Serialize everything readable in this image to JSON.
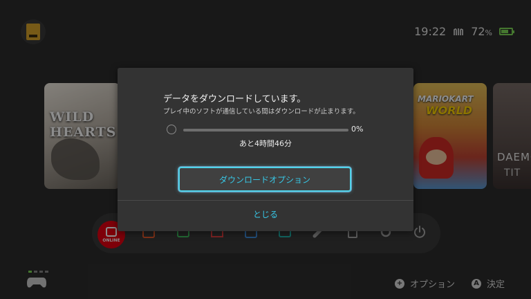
{
  "status": {
    "time": "19:22",
    "battery_percent": "72",
    "battery_unit": "%",
    "battery_level": 0.72
  },
  "games": [
    "WILD HEARTS",
    "MARIO KART WORLD",
    "DAEMON X MACHINA TITANIC SCION"
  ],
  "game_tile_text": {
    "wild_hearts": "WILD HEARTS",
    "mario_kart_1": "MARIOKART",
    "mario_kart_2": "WORLD",
    "daemon": "DAEMO",
    "daemon_sub": "TIT"
  },
  "dock": {
    "online_label": "ONLINE"
  },
  "dialog": {
    "title": "データをダウンロードしています。",
    "subtitle": "プレイ中のソフトが通信している間はダウンロードが止まります。",
    "progress_label": "0%",
    "progress_value": 0.0,
    "time_remaining": "あと4時間46分",
    "options_button": "ダウンロードオプション",
    "close_button": "とじる"
  },
  "bottom_hints": {
    "plus_symbol": "+",
    "plus_label": "オプション",
    "a_symbol": "A",
    "a_label": "決定"
  },
  "colors": {
    "accent": "#37c7e6",
    "online_red": "#e60012",
    "battery_green": "#7ed957"
  }
}
